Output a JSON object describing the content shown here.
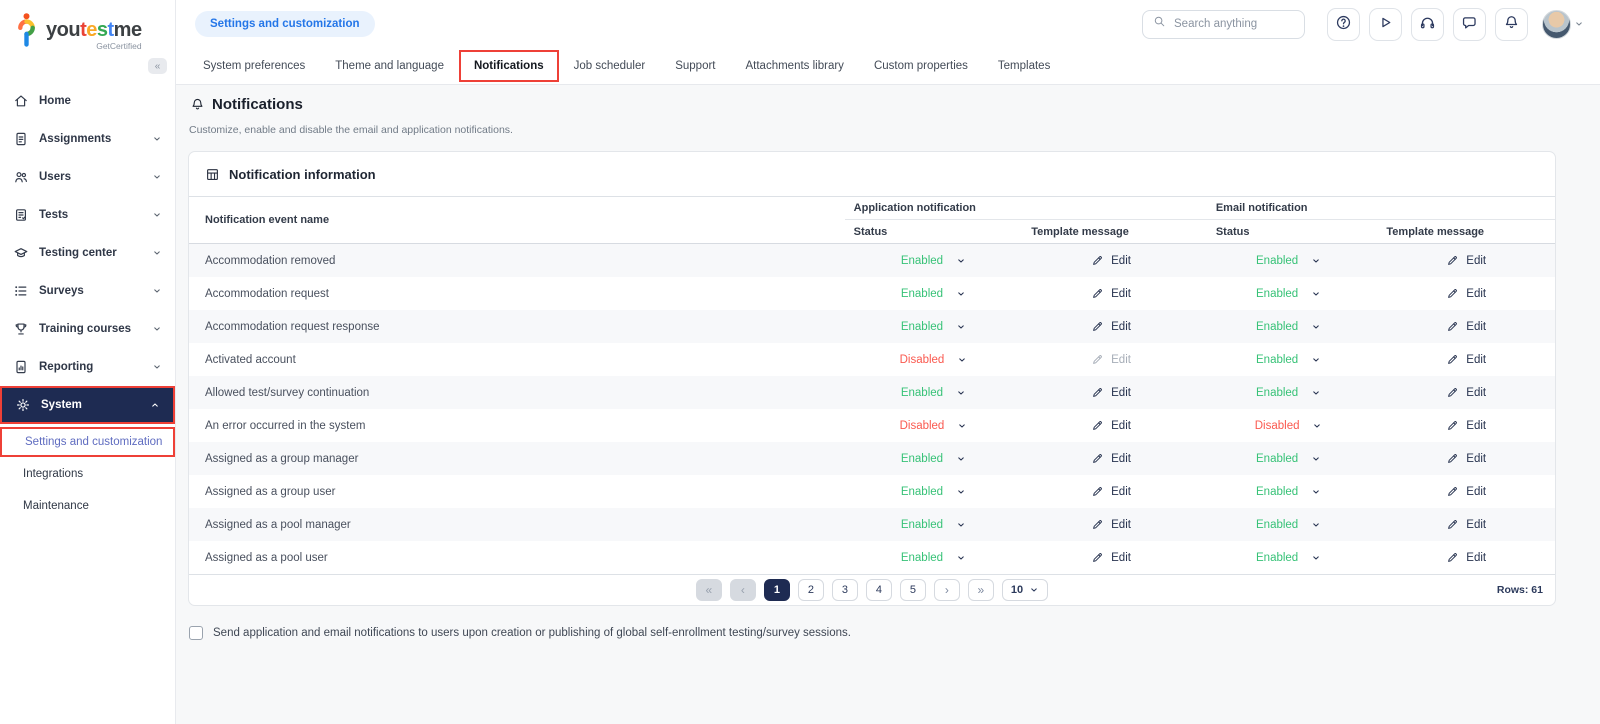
{
  "colors": {
    "navy": "#1e2b52",
    "status_enabled_green": "#37c277",
    "status_disabled_red": "#fa594f",
    "highlight_red": "#ee4037",
    "breadcrumb_blue": "#2476e8",
    "active_subitem_blue": "#5f6cc0"
  },
  "logo": {
    "segments": [
      {
        "text": "you",
        "color": "#3c4043"
      },
      {
        "text": "t",
        "color": "#ea4335"
      },
      {
        "text": "e",
        "color": "#f9a825"
      },
      {
        "text": "s",
        "color": "#34a853"
      },
      {
        "text": "t",
        "color": "#4285f4"
      },
      {
        "text": "me",
        "color": "#3c4043"
      }
    ],
    "tagline": "GetCertified",
    "collapse_glyph": "«"
  },
  "sidebar": {
    "items": [
      {
        "label": "Home",
        "icon": "home-icon",
        "chevron": false,
        "active": false
      },
      {
        "label": "Assignments",
        "icon": "assignments-icon",
        "chevron": true,
        "active": false
      },
      {
        "label": "Users",
        "icon": "users-icon",
        "chevron": true,
        "active": false
      },
      {
        "label": "Tests",
        "icon": "tests-icon",
        "chevron": true,
        "active": false
      },
      {
        "label": "Testing center",
        "icon": "testing-center-icon",
        "chevron": true,
        "active": false
      },
      {
        "label": "Surveys",
        "icon": "surveys-icon",
        "chevron": true,
        "active": false
      },
      {
        "label": "Training courses",
        "icon": "training-courses-icon",
        "chevron": true,
        "active": false
      },
      {
        "label": "Reporting",
        "icon": "reporting-icon",
        "chevron": true,
        "active": false
      },
      {
        "label": "System",
        "icon": "system-icon",
        "chevron": true,
        "active": true,
        "expanded": true
      }
    ],
    "subitems": [
      {
        "label": "Settings and customization",
        "active": true
      },
      {
        "label": "Integrations",
        "active": false
      },
      {
        "label": "Maintenance",
        "active": false
      }
    ]
  },
  "header": {
    "breadcrumb": "Settings and customization",
    "search_placeholder": "Search anything",
    "icon_buttons": [
      "help-icon",
      "play-icon",
      "headphones-icon",
      "chat-icon",
      "bell-icon"
    ]
  },
  "tabs": [
    "System preferences",
    "Theme and language",
    "Notifications",
    "Job scheduler",
    "Support",
    "Attachments library",
    "Custom properties",
    "Templates"
  ],
  "active_tab": "Notifications",
  "page": {
    "title": "Notifications",
    "subtitle": "Customize, enable and disable the email and application notifications."
  },
  "table": {
    "title": "Notification information",
    "col_event": "Notification event name",
    "group_app": "Application notification",
    "group_email": "Email notification",
    "col_status": "Status",
    "col_template": "Template message",
    "edit_label": "Edit",
    "rows": [
      {
        "name": "Accommodation removed",
        "app_status": "Enabled",
        "app_edit_enabled": true,
        "email_status": "Enabled",
        "email_edit_enabled": true
      },
      {
        "name": "Accommodation request",
        "app_status": "Enabled",
        "app_edit_enabled": true,
        "email_status": "Enabled",
        "email_edit_enabled": true
      },
      {
        "name": "Accommodation request response",
        "app_status": "Enabled",
        "app_edit_enabled": true,
        "email_status": "Enabled",
        "email_edit_enabled": true
      },
      {
        "name": "Activated account",
        "app_status": "Disabled",
        "app_edit_enabled": false,
        "email_status": "Enabled",
        "email_edit_enabled": true
      },
      {
        "name": "Allowed test/survey continuation",
        "app_status": "Enabled",
        "app_edit_enabled": true,
        "email_status": "Enabled",
        "email_edit_enabled": true
      },
      {
        "name": "An error occurred in the system",
        "app_status": "Disabled",
        "app_edit_enabled": true,
        "email_status": "Disabled",
        "email_edit_enabled": true
      },
      {
        "name": "Assigned as a group manager",
        "app_status": "Enabled",
        "app_edit_enabled": true,
        "email_status": "Enabled",
        "email_edit_enabled": true
      },
      {
        "name": "Assigned as a group user",
        "app_status": "Enabled",
        "app_edit_enabled": true,
        "email_status": "Enabled",
        "email_edit_enabled": true
      },
      {
        "name": "Assigned as a pool manager",
        "app_status": "Enabled",
        "app_edit_enabled": true,
        "email_status": "Enabled",
        "email_edit_enabled": true
      },
      {
        "name": "Assigned as a pool user",
        "app_status": "Enabled",
        "app_edit_enabled": true,
        "email_status": "Enabled",
        "email_edit_enabled": true
      }
    ]
  },
  "pagination": {
    "first_glyph": "«",
    "prev_glyph": "‹",
    "next_glyph": "›",
    "last_glyph": "»",
    "pages": [
      "1",
      "2",
      "3",
      "4",
      "5"
    ],
    "active_page": "1",
    "page_size": "10",
    "rows_label": "Rows: 61"
  },
  "footer": {
    "checkbox_label": "Send application and email notifications to users upon creation or publishing of global self-enrollment testing/survey sessions.",
    "checked": false
  }
}
